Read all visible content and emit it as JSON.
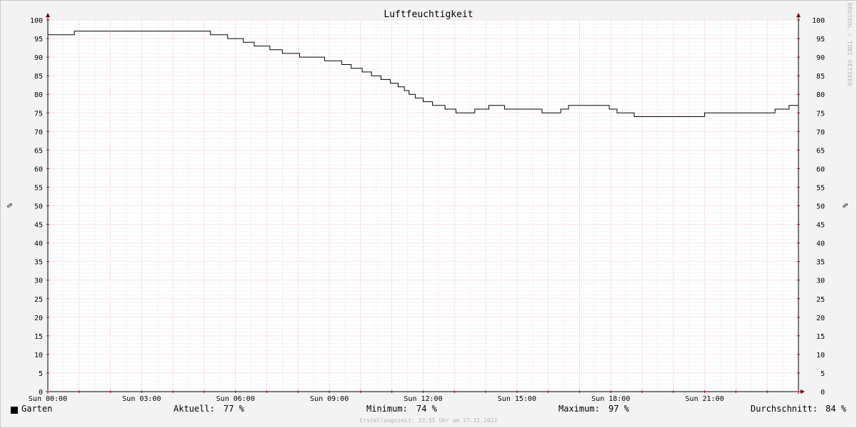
{
  "chart_data": {
    "type": "line",
    "title": "Luftfeuchtigkeit",
    "ylabel": "%",
    "ylabel_right": "%",
    "ylim": [
      0,
      100
    ],
    "y_ticks": [
      0,
      5,
      10,
      15,
      20,
      25,
      30,
      35,
      40,
      45,
      50,
      55,
      60,
      65,
      70,
      75,
      80,
      85,
      90,
      95,
      100
    ],
    "x_ticks": [
      "Sun 00:00",
      "Sun 03:00",
      "Sun 06:00",
      "Sun 09:00",
      "Sun 12:00",
      "Sun 15:00",
      "Sun 18:00",
      "Sun 21:00"
    ],
    "x_tick_hours": [
      0,
      3,
      6,
      9,
      12,
      15,
      18,
      21
    ],
    "xlim_hours": [
      0,
      24
    ],
    "grid": true,
    "colors": {
      "line": "#000000",
      "major_grid": "#e0a0a8",
      "minor_grid": "#d0d0d0",
      "axis": "#000000",
      "arrow": "#7a0000"
    },
    "series": [
      {
        "name": "Garten",
        "step": true,
        "points_hours": [
          [
            0.0,
            96
          ],
          [
            0.85,
            97
          ],
          [
            5.2,
            96
          ],
          [
            5.75,
            95
          ],
          [
            6.25,
            94
          ],
          [
            6.6,
            93
          ],
          [
            7.1,
            92
          ],
          [
            7.5,
            91
          ],
          [
            8.05,
            90
          ],
          [
            8.85,
            89
          ],
          [
            9.4,
            88
          ],
          [
            9.7,
            87
          ],
          [
            10.05,
            86
          ],
          [
            10.35,
            85
          ],
          [
            10.65,
            84
          ],
          [
            10.95,
            83
          ],
          [
            11.2,
            82
          ],
          [
            11.4,
            81
          ],
          [
            11.55,
            80
          ],
          [
            11.75,
            79
          ],
          [
            12.0,
            78
          ],
          [
            12.3,
            77
          ],
          [
            12.7,
            76
          ],
          [
            13.05,
            75
          ],
          [
            13.65,
            76
          ],
          [
            14.1,
            77
          ],
          [
            14.6,
            76
          ],
          [
            15.8,
            75
          ],
          [
            16.4,
            76
          ],
          [
            16.65,
            77
          ],
          [
            17.95,
            76
          ],
          [
            18.2,
            75
          ],
          [
            18.75,
            74
          ],
          [
            21.0,
            75
          ],
          [
            23.25,
            76
          ],
          [
            23.7,
            77
          ],
          [
            24.0,
            77
          ]
        ]
      }
    ]
  },
  "legend": {
    "series_name": "Garten",
    "current_label": "Aktuell:",
    "current_value": "77 %",
    "min_label": "Minimum:",
    "min_value": "74 %",
    "max_label": "Maximum:",
    "max_value": "97 %",
    "avg_label": "Durchschnitt:",
    "avg_value": "84 %"
  },
  "footer": "Erstellungszeit: 23:55 Uhr am 27.11.2022",
  "watermark": "RRDTOOL / TOBI OETIKER"
}
